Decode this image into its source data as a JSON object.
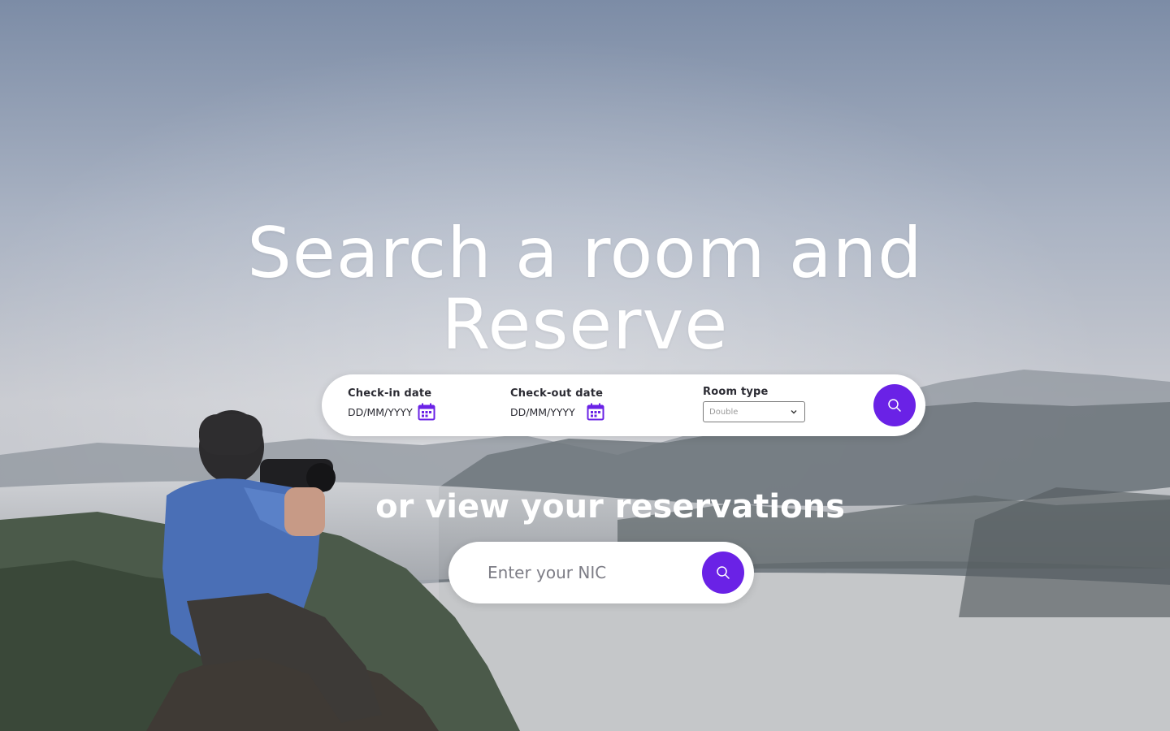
{
  "hero": {
    "headline_line1": "Search a room and",
    "headline_line2": "Reserve",
    "subheading": "or view your reservations"
  },
  "search": {
    "checkin_label": "Check-in date",
    "checkin_value": "DD/MM/YYYY",
    "checkout_label": "Check-out date",
    "checkout_value": "DD/MM/YYYY",
    "room_type_label": "Room type",
    "room_type_value": "Double",
    "search_icon": "search-icon",
    "calendar_icon": "calendar-icon"
  },
  "reservations": {
    "nic_placeholder": "Enter your NIC",
    "search_icon": "search-icon"
  },
  "colors": {
    "accent": "#6a22e6",
    "bar_bg": "#ffffff",
    "heading": "#ffffff"
  }
}
